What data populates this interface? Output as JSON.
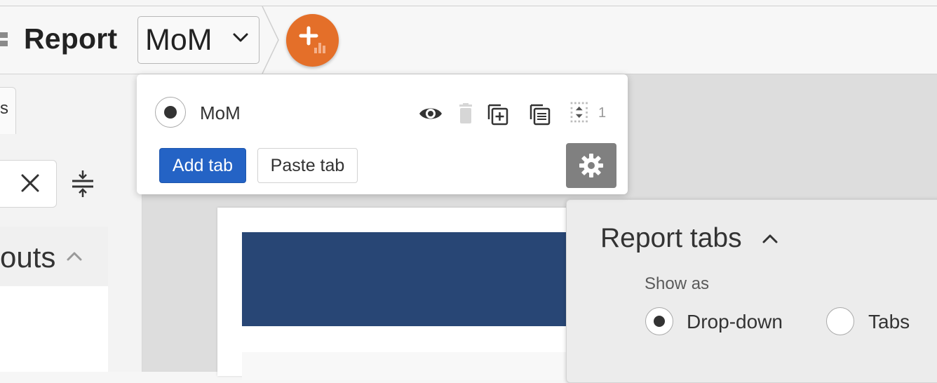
{
  "header": {
    "title": "Report",
    "selected_tab": "MoM"
  },
  "sidebar": {
    "tab_fragment": "s",
    "section_fragment": "outs"
  },
  "tab_popover": {
    "tab_name": "MoM",
    "order_value": "1",
    "add_tab_label": "Add tab",
    "paste_tab_label": "Paste tab"
  },
  "report_tabs_panel": {
    "title": "Report tabs",
    "show_as_label": "Show as",
    "options": [
      {
        "label": "Drop-down",
        "selected": true
      },
      {
        "label": "Tabs",
        "selected": false
      }
    ]
  },
  "colors": {
    "accent_orange": "#e46f29",
    "primary_button": "#2463c5",
    "banner": "#284675",
    "settings_gear_bg": "#808080"
  },
  "icons": [
    "menu-icon",
    "chevron-down-icon",
    "add-widget-icon",
    "close-icon",
    "collapse-icon",
    "eye-icon",
    "trash-icon",
    "duplicate-icon",
    "copy-icon",
    "reorder-icon",
    "gear-icon",
    "chevron-up-icon"
  ]
}
